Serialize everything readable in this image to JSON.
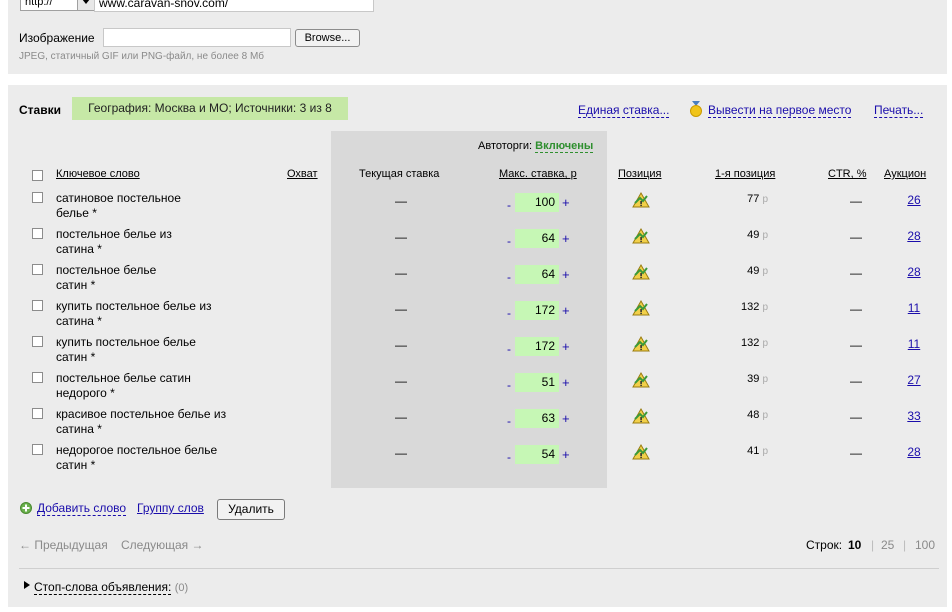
{
  "form": {
    "protocol": "http://",
    "url": "www.caravan-snov.com/",
    "image_label": "Изображение",
    "browse_label": "Browse...",
    "image_hint": "JPEG, статичный GIF или PNG-файл, не более 8 Мб"
  },
  "bids": {
    "title": "Ставки",
    "geo_badge": "География: Москва и МО; Источники: 3 из 8",
    "single_bid": "Единая ставка...",
    "first_place": "Вывести на первое место",
    "print": "Печать...",
    "autobid_label": "Автоторги:",
    "autobid_value": "Включены"
  },
  "table": {
    "headers": {
      "keyword": "Ключевое слово",
      "reach": "Охват",
      "current_bid": "Текущая ставка",
      "max_bid": "Макс. ставка, р",
      "position": "Позиция",
      "first_position": "1-я позиция",
      "ctr": "CTR, %",
      "auction": "Аукцион"
    },
    "rows": [
      {
        "line1": "сатиновое постельное",
        "line2": "белье  *",
        "current": "—",
        "max_bid": "100",
        "first_pos": "77",
        "ctr": "—",
        "auction": "26"
      },
      {
        "line1": "постельное белье из",
        "line2": "сатина  *",
        "current": "—",
        "max_bid": "64",
        "first_pos": "49",
        "ctr": "—",
        "auction": "28"
      },
      {
        "line1": "постельное белье",
        "line2": "сатин  *",
        "current": "—",
        "max_bid": "64",
        "first_pos": "49",
        "ctr": "—",
        "auction": "28"
      },
      {
        "line1": "купить постельное белье из",
        "line2": "сатина  *",
        "current": "—",
        "max_bid": "172",
        "first_pos": "132",
        "ctr": "—",
        "auction": "11"
      },
      {
        "line1": "купить постельное белье",
        "line2": "сатин  *",
        "current": "—",
        "max_bid": "172",
        "first_pos": "132",
        "ctr": "—",
        "auction": "11"
      },
      {
        "line1": "постельное белье сатин",
        "line2": "недорого  *",
        "current": "—",
        "max_bid": "51",
        "first_pos": "39",
        "ctr": "—",
        "auction": "27"
      },
      {
        "line1": "красивое постельное белье из",
        "line2": "сатина  *",
        "current": "—",
        "max_bid": "63",
        "first_pos": "48",
        "ctr": "—",
        "auction": "33"
      },
      {
        "line1": "недорогое постельное белье",
        "line2": "сатин  *",
        "current": "—",
        "max_bid": "54",
        "first_pos": "41",
        "ctr": "—",
        "auction": "28"
      }
    ],
    "minus": "-",
    "plus": "+",
    "rub": "р"
  },
  "actions": {
    "add_word": "Добавить слово",
    "group_words": "Группу слов",
    "delete": "Удалить"
  },
  "pagination": {
    "prev": "← Предыдущая",
    "next": "Следующая →",
    "rows_label": "Строк:",
    "rows_10": "10",
    "sep": "|",
    "rows_25": "25",
    "rows_100": "100"
  },
  "stop_words": {
    "label": "Стоп-слова объявления:",
    "count": "(0)"
  }
}
